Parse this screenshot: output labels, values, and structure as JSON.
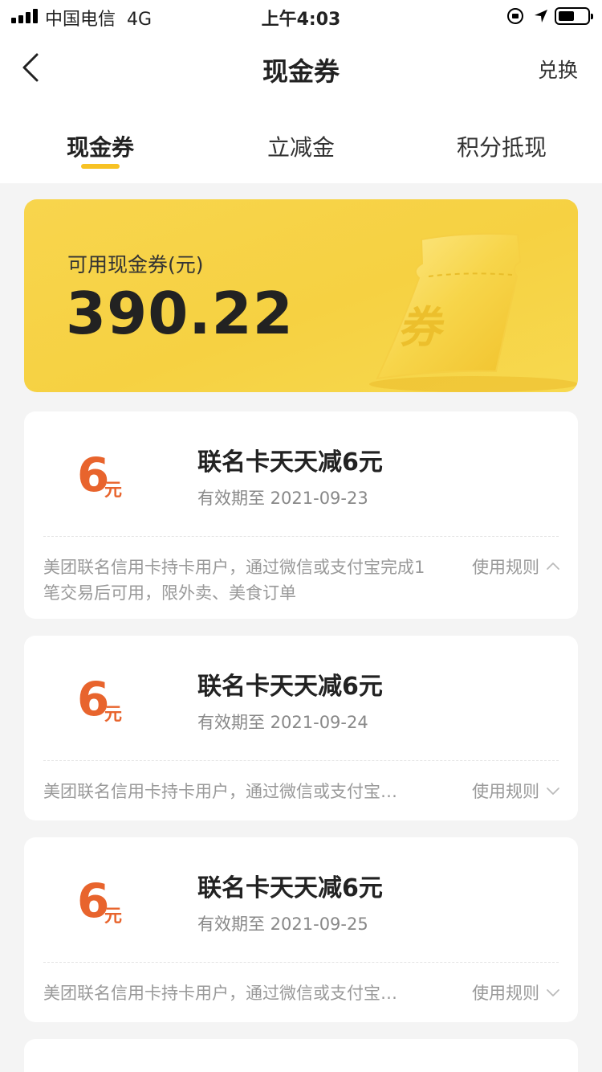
{
  "status_bar": {
    "carrier": "中国电信",
    "network": "4G",
    "time": "上午4:03",
    "battery_level": 0.55
  },
  "nav": {
    "title": "现金券",
    "action_label": "兑换"
  },
  "tabs": [
    {
      "label": "现金券",
      "active": true
    },
    {
      "label": "立减金",
      "active": false
    },
    {
      "label": "积分抵现",
      "active": false
    }
  ],
  "summary": {
    "label": "可用现金券(元)",
    "value": "390.22",
    "art_text": "券"
  },
  "coupons": [
    {
      "amount": "6",
      "unit": "元",
      "title": "联名卡天天减6元",
      "validity": "有效期至 2021-09-23",
      "description": "美团联名信用卡持卡用户，通过微信或支付宝完成1笔交易后可用，限外卖、美食订单",
      "rules_label": "使用规则",
      "expanded": true
    },
    {
      "amount": "6",
      "unit": "元",
      "title": "联名卡天天减6元",
      "validity": "有效期至 2021-09-24",
      "description": "美团联名信用卡持卡用户，通过微信或支付宝…",
      "rules_label": "使用规则",
      "expanded": false
    },
    {
      "amount": "6",
      "unit": "元",
      "title": "联名卡天天减6元",
      "validity": "有效期至 2021-09-25",
      "description": "美团联名信用卡持卡用户，通过微信或支付宝…",
      "rules_label": "使用规则",
      "expanded": false
    }
  ],
  "colors": {
    "accent": "#f7c224",
    "coupon_amount": "#e8642d",
    "banner": "#f6d142"
  }
}
